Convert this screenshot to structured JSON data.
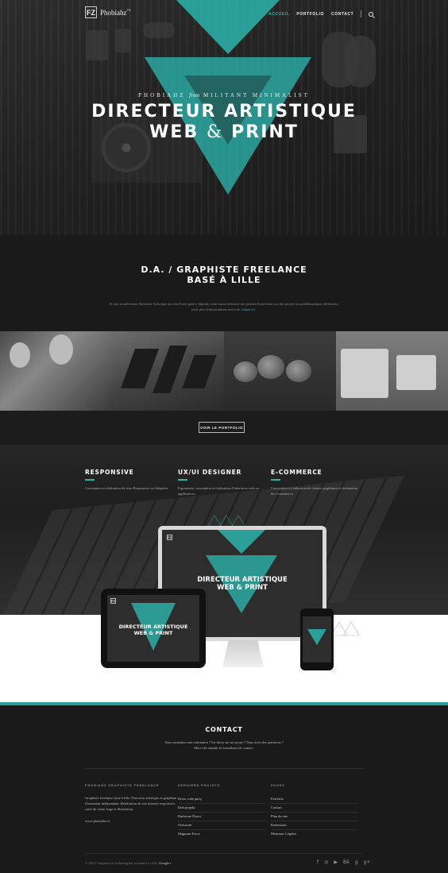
{
  "header": {
    "logo_mark": "FZ",
    "logo_text": "Phobiahz",
    "logo_sup": "™",
    "nav": [
      {
        "label": "ACCUEIL",
        "active": true
      },
      {
        "label": "PORTFOLIO",
        "active": false
      },
      {
        "label": "CONTACT",
        "active": false
      }
    ],
    "search_icon": "search-icon"
  },
  "hero": {
    "sub_left": "PHOBIAHZ",
    "sub_mid": "from",
    "sub_right": "MILITANT MINIMALIST",
    "title_line1": "DIRECTEUR ARTISTIQUE",
    "title_line2_a": "WEB",
    "title_amp": "&",
    "title_line2_b": "PRINT"
  },
  "intro": {
    "title_line1": "D.A. / GRAPHISTE FREELANCE",
    "title_line2": "BASÉ À LILLE",
    "text": "Je suis actuellement Directeur Artistique au sein d'une agence digitale, mon statut freelance me permet d'intervenir sur des projets ou problématiques différentes,",
    "text2": "pour plus d'informations merci de ",
    "link": "cliquer ici."
  },
  "portfolio_button": "VOIR LE PORTFOLIO",
  "services": [
    {
      "title": "RESPONSIVE",
      "text": "Conception et réalisation de sites Responsive ou Adaptive."
    },
    {
      "title": "UX/UI DESIGNER",
      "text": "Ergonomie, conception et réalisation d'interfaces web ou applicatives."
    },
    {
      "title": "E-COMMERCE",
      "text": "Conception et réalisation de chartes graphiques à destination du e-commerce."
    }
  ],
  "devices": {
    "monitor_title1": "DIRECTEUR ARTISTIQUE",
    "monitor_title2": "WEB & PRINT",
    "tablet_title1": "DIRECTEUR ARTISTIQUE",
    "tablet_title2": "WEB & PRINT",
    "mini_logo": "FZ"
  },
  "contact": {
    "title": "CONTACT",
    "line1": "Vous souhaitez une estimation ? Un devis sur un projet ? Vous avez des questions ?",
    "line2": "Merci de remplir le formulaire de contact."
  },
  "footer": {
    "col1": {
      "heading": "PHOBIAHZ GRAPHISTE FREELANCE",
      "text": "Graphiste freelance situé à lille. Directeur artistique et graphiste illustrateur indépendant. Réalisation de site internet responsive, carte de visite, logo et illustration.",
      "url": "www.phobiahz.fr"
    },
    "col2": {
      "heading": "DERNIERS PROJETS",
      "items": [
        "Dress code party",
        "Dub projekt",
        "Barbecue Direct",
        "Osécurité",
        "Magnum Force"
      ]
    },
    "col3": {
      "heading": "PAGES",
      "items": [
        "Portfolio",
        "Contact",
        "Plan du site",
        "Partenaires",
        "Mentions Légales"
      ]
    },
    "copyright": "© 2014 Graphiste et webdesigner freelance à Lille.",
    "google": "Google+",
    "social": [
      "f",
      "◎",
      "▶",
      "Bē",
      "g",
      "g+"
    ]
  },
  "colors": {
    "accent": "#2bb5ad",
    "teal_line": "#2a9d96",
    "dark_bg": "#1a1a1a"
  }
}
